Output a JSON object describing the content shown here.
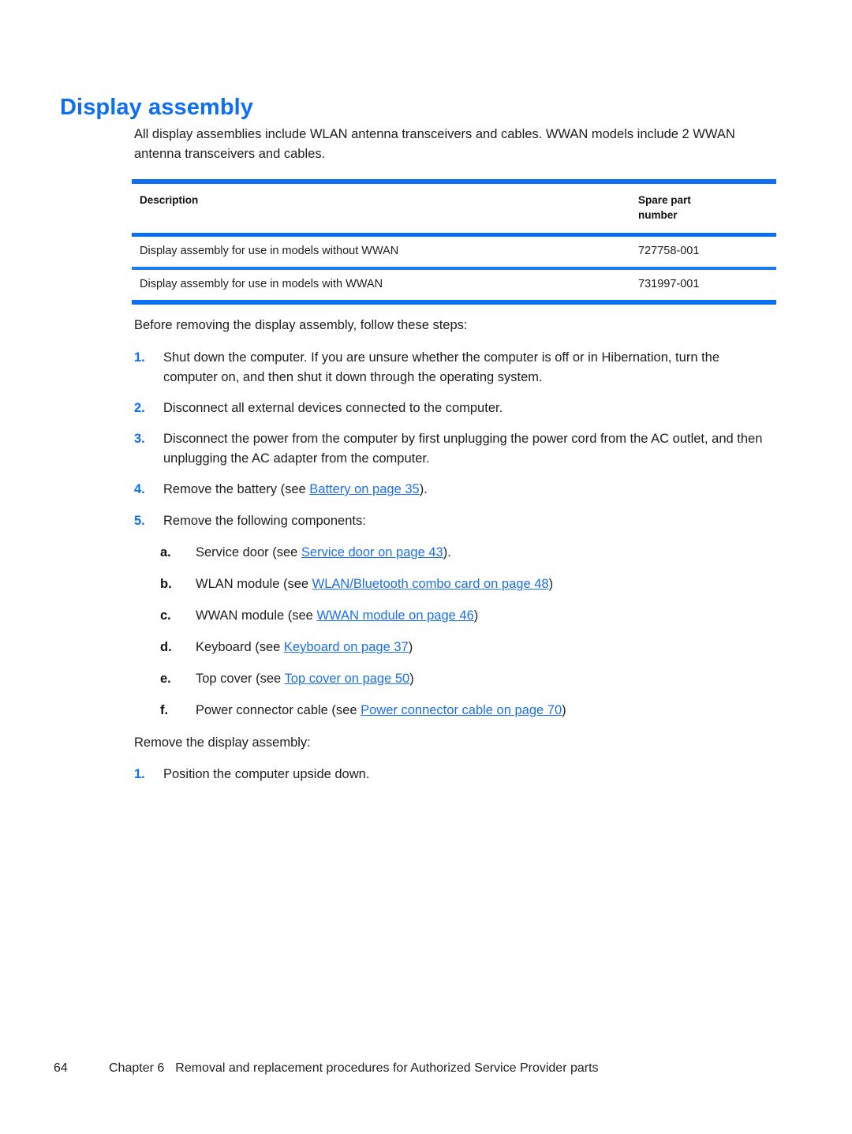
{
  "document": {
    "heading": "Display assembly",
    "intro": "All display assemblies include WLAN antenna transceivers and cables. WWAN models include 2 WWAN antenna transceivers and cables."
  },
  "table": {
    "headers": {
      "description": "Description",
      "spare_part_number_line1": "Spare part",
      "spare_part_number_line2": "number"
    },
    "rows": [
      {
        "description": "Display assembly for use in models without WWAN",
        "spare_part_number": "727758-001"
      },
      {
        "description": "Display assembly for use in models with WWAN",
        "spare_part_number": "731997-001"
      }
    ]
  },
  "before_section": {
    "lead_in": "Before removing the display assembly, follow these steps:",
    "steps": [
      {
        "marker": "1.",
        "text": "Shut down the computer. If you are unsure whether the computer is off or in Hibernation, turn the computer on, and then shut it down through the operating system."
      },
      {
        "marker": "2.",
        "text": "Disconnect all external devices connected to the computer."
      },
      {
        "marker": "3.",
        "text": "Disconnect the power from the computer by first unplugging the power cord from the AC outlet, and then unplugging the AC adapter from the computer."
      },
      {
        "marker": "4.",
        "prefix": "Remove the battery (see ",
        "link": "Battery on page 35",
        "suffix": ")."
      },
      {
        "marker": "5.",
        "text": "Remove the following components:"
      }
    ],
    "substeps": [
      {
        "marker": "a.",
        "prefix": "Service door (see ",
        "link": "Service door on page 43",
        "suffix": ")."
      },
      {
        "marker": "b.",
        "prefix": "WLAN module (see ",
        "link": "WLAN/Bluetooth combo card on page 48",
        "suffix": ")"
      },
      {
        "marker": "c.",
        "prefix": "WWAN module (see ",
        "link": "WWAN module on page 46",
        "suffix": ")"
      },
      {
        "marker": "d.",
        "prefix": "Keyboard (see ",
        "link": "Keyboard on page 37",
        "suffix": ")"
      },
      {
        "marker": "e.",
        "prefix": "Top cover (see ",
        "link": "Top cover on page 50",
        "suffix": ")"
      },
      {
        "marker": "f.",
        "prefix": "Power connector cable (see ",
        "link": "Power connector cable on page 70",
        "suffix": ")"
      }
    ]
  },
  "remove_section": {
    "lead_in": "Remove the display assembly:",
    "steps": [
      {
        "marker": "1.",
        "text": "Position the computer upside down."
      }
    ]
  },
  "footer": {
    "page_number": "64",
    "chapter": "Chapter 6",
    "chapter_title": "Removal and replacement procedures for Authorized Service Provider parts"
  },
  "colors": {
    "accent_blue": "#0c6ef2",
    "link_blue": "#1a6ef0",
    "body_text": "#1d1d1d"
  }
}
